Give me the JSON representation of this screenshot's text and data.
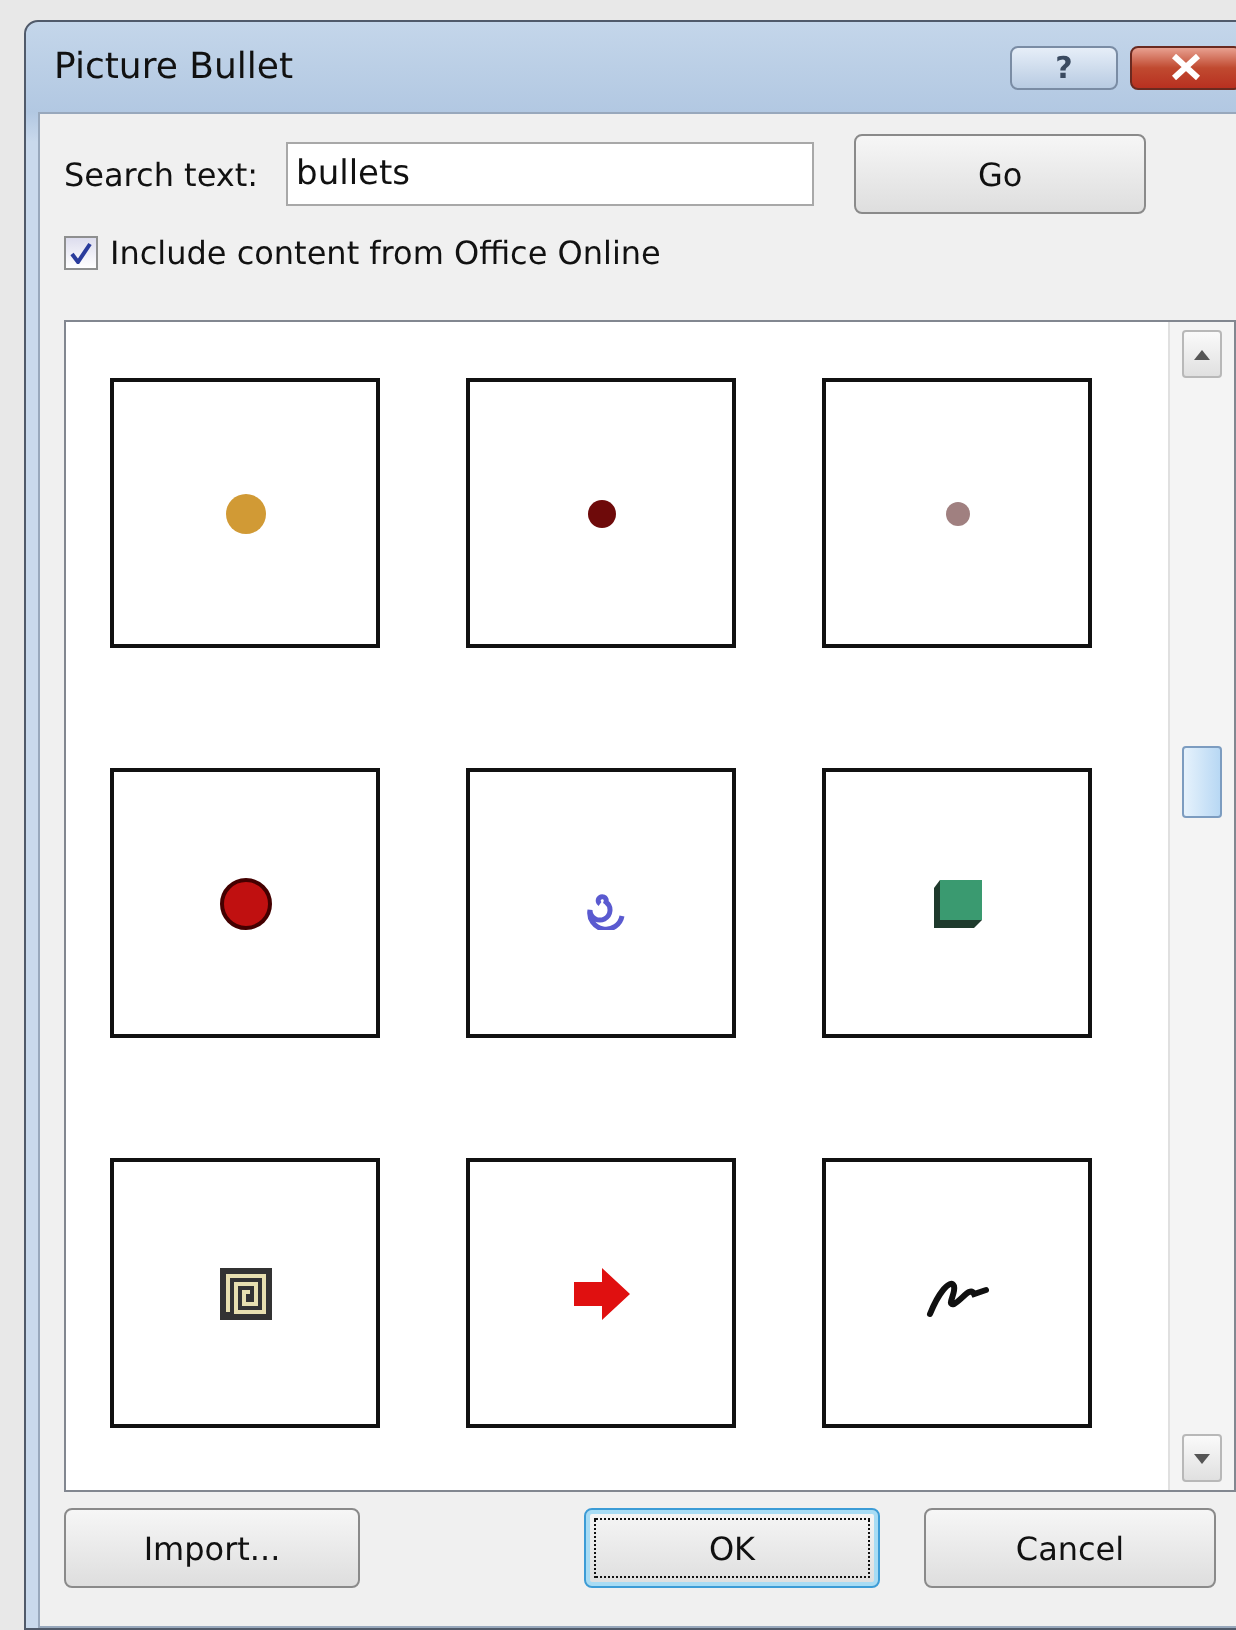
{
  "window": {
    "title": "Picture Bullet",
    "help_button": "?"
  },
  "search": {
    "label": "Search text:",
    "value": "bullets",
    "button": "Go"
  },
  "include_online": {
    "label": "Include content from Office Online",
    "checked": true
  },
  "bullets": [
    {
      "kind": "dot",
      "color": "#d19a35"
    },
    {
      "kind": "dot",
      "color": "#6e0a0a"
    },
    {
      "kind": "dot",
      "color": "#a08080"
    },
    {
      "kind": "sphere",
      "color": "#c01010"
    },
    {
      "kind": "spiral",
      "color": "#5a5ad0"
    },
    {
      "kind": "cube",
      "color": "#3a9a70"
    },
    {
      "kind": "maze",
      "color": "#333333"
    },
    {
      "kind": "arrow",
      "color": "#e01010"
    },
    {
      "kind": "squiggle",
      "color": "#101010"
    }
  ],
  "buttons": [
    {
      "label": "Import...",
      "default": false
    },
    {
      "label": "OK",
      "default": true
    },
    {
      "label": "Cancel",
      "default": false
    }
  ]
}
